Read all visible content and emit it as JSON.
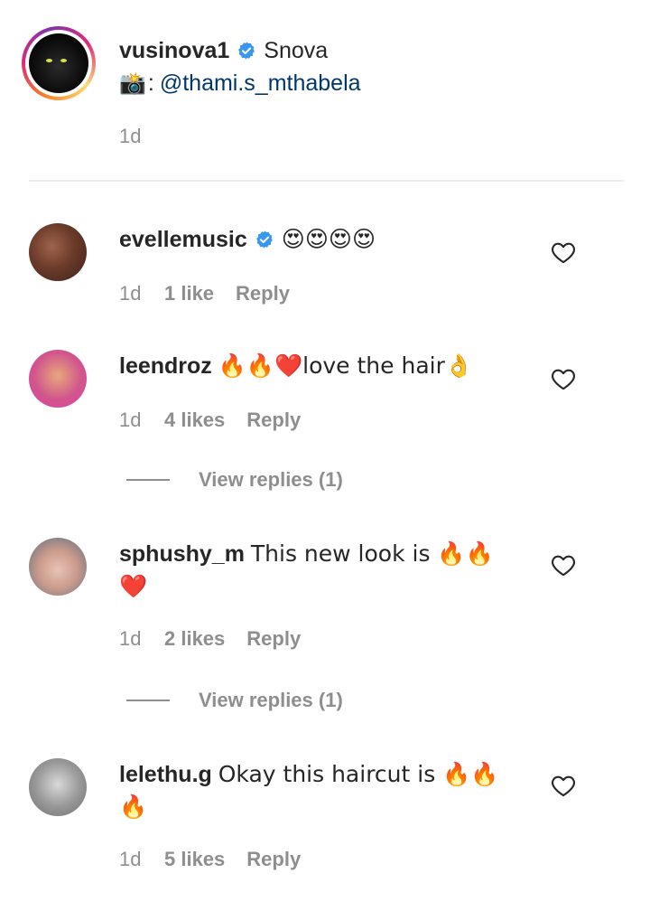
{
  "post": {
    "username": "vusinova1",
    "verified": true,
    "caption": "Snova",
    "camera_emoji": "📸",
    "colon": ":",
    "mention": "@thami.s_mthabela",
    "time": "1d"
  },
  "comments": [
    {
      "username": "evellemusic",
      "verified": true,
      "text": "😍😍😍😍",
      "time": "1d",
      "likes": "1 like",
      "reply": "Reply"
    },
    {
      "username": "leendroz",
      "verified": false,
      "text": "🔥🔥❤️love the hair👌",
      "time": "1d",
      "likes": "4 likes",
      "reply": "Reply",
      "view_replies": "View replies (1)"
    },
    {
      "username": "sphushy_m",
      "verified": false,
      "text": "This new look is 🔥🔥❤️",
      "time": "1d",
      "likes": "2 likes",
      "reply": "Reply",
      "view_replies": "View replies (1)"
    },
    {
      "username": "lelethu.g",
      "verified": false,
      "text": "Okay this haircut is 🔥🔥🔥",
      "time": "1d",
      "likes": "5 likes",
      "reply": "Reply"
    }
  ],
  "colors": {
    "text": "#262626",
    "secondary": "#8e8e8e",
    "mention": "#00376b",
    "verified": "#3897f0",
    "divider": "#efefef"
  },
  "icons": {
    "verified": "verified-badge-icon",
    "like": "heart-outline-icon"
  }
}
